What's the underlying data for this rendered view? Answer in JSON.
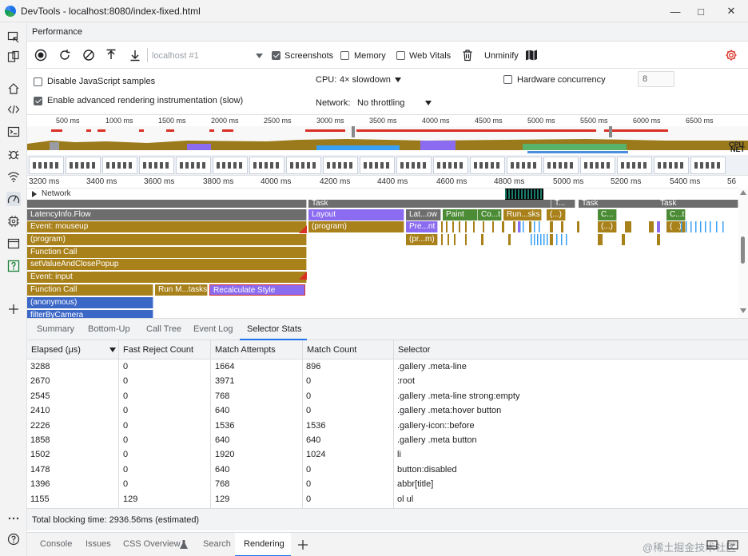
{
  "window": {
    "title": "DevTools - localhost:8080/index-fixed.html"
  },
  "panel": {
    "title": "Performance"
  },
  "toolbar": {
    "target": "localhost #1",
    "screenshots_label": "Screenshots",
    "memory_label": "Memory",
    "webvitals_label": "Web Vitals",
    "unminify_label": "Unminify"
  },
  "settings": {
    "disable_js_samples": "Disable JavaScript samples",
    "advanced_rendering": "Enable advanced rendering instrumentation (slow)",
    "cpu_label": "CPU:",
    "cpu_value": "4× slowdown",
    "network_label": "Network:",
    "network_value": "No throttling",
    "hw_concurrency_label": "Hardware concurrency",
    "hw_concurrency_value": "8"
  },
  "overview": {
    "ticks": [
      "500 ms",
      "1000 ms",
      "1500 ms",
      "2000 ms",
      "2500 ms",
      "3000 ms",
      "3500 ms",
      "4000 ms",
      "4500 ms",
      "5000 ms",
      "5500 ms",
      "6000 ms",
      "6500 ms"
    ],
    "cpu_label": "CPU",
    "net_label": "NET"
  },
  "timeline": {
    "ticks": [
      "3200 ms",
      "3400 ms",
      "3600 ms",
      "3800 ms",
      "4000 ms",
      "4200 ms",
      "4400 ms",
      "4600 ms",
      "4800 ms",
      "5000 ms",
      "5200 ms",
      "5400 ms",
      "56"
    ],
    "network_label": "Network",
    "flame": {
      "task": "Task",
      "task_short": "T...",
      "latency": "LatencyInfo.Flow",
      "mouseup": "Event: mouseup",
      "program": "(program)",
      "function_call": "Function Call",
      "set_value": "setValueAndClosePopup",
      "event_input": "Event: input",
      "run_tasks": "Run M...tasks",
      "recalc": "Recalculate Style",
      "anonymous": "(anonymous)",
      "filter": "filterByCamera",
      "layout": "Layout",
      "lat_ow": "Lat...ow",
      "paint": "Paint",
      "co_t": "Co...t",
      "run_sks": "Run...sks",
      "ellipsis": "(...)",
      "c_short": "C...",
      "ct_short": "C...t",
      "pre_nt": "Pre...nt",
      "pr_m": "(pr...m)"
    }
  },
  "bottom_tabs": [
    "Summary",
    "Bottom-Up",
    "Call Tree",
    "Event Log",
    "Selector Stats"
  ],
  "table": {
    "headers": [
      "Elapsed (μs)",
      "Fast Reject Count",
      "Match Attempts",
      "Match Count",
      "Selector"
    ],
    "rows": [
      [
        "3288",
        "0",
        "1664",
        "896",
        ".gallery .meta-line"
      ],
      [
        "2670",
        "0",
        "3971",
        "0",
        ":root"
      ],
      [
        "2545",
        "0",
        "768",
        "0",
        ".gallery .meta-line strong:empty"
      ],
      [
        "2410",
        "0",
        "640",
        "0",
        ".gallery .meta:hover button"
      ],
      [
        "2226",
        "0",
        "1536",
        "1536",
        ".gallery-icon::before"
      ],
      [
        "1858",
        "0",
        "640",
        "640",
        ".gallery .meta button"
      ],
      [
        "1502",
        "0",
        "1920",
        "1024",
        "li"
      ],
      [
        "1478",
        "0",
        "640",
        "0",
        "button:disabled"
      ],
      [
        "1396",
        "0",
        "768",
        "0",
        "abbr[title]"
      ],
      [
        "1155",
        "129",
        "129",
        "0",
        "ol ul"
      ]
    ]
  },
  "status": {
    "total_blocking_time": "Total blocking time: 2936.56ms (estimated)"
  },
  "drawer_tabs": [
    "Console",
    "Issues",
    "CSS Overview",
    "Search",
    "Rendering"
  ],
  "watermark": "@稀土掘金技术社区",
  "colors": {
    "task_gray": "#6d6d6d",
    "scripting_yellow": "#a9811a",
    "rendering_purple": "#8b6cf0",
    "painting_green": "#4b8b35",
    "accent_blue": "#1a73e8",
    "function_blue": "#3b67c7"
  }
}
